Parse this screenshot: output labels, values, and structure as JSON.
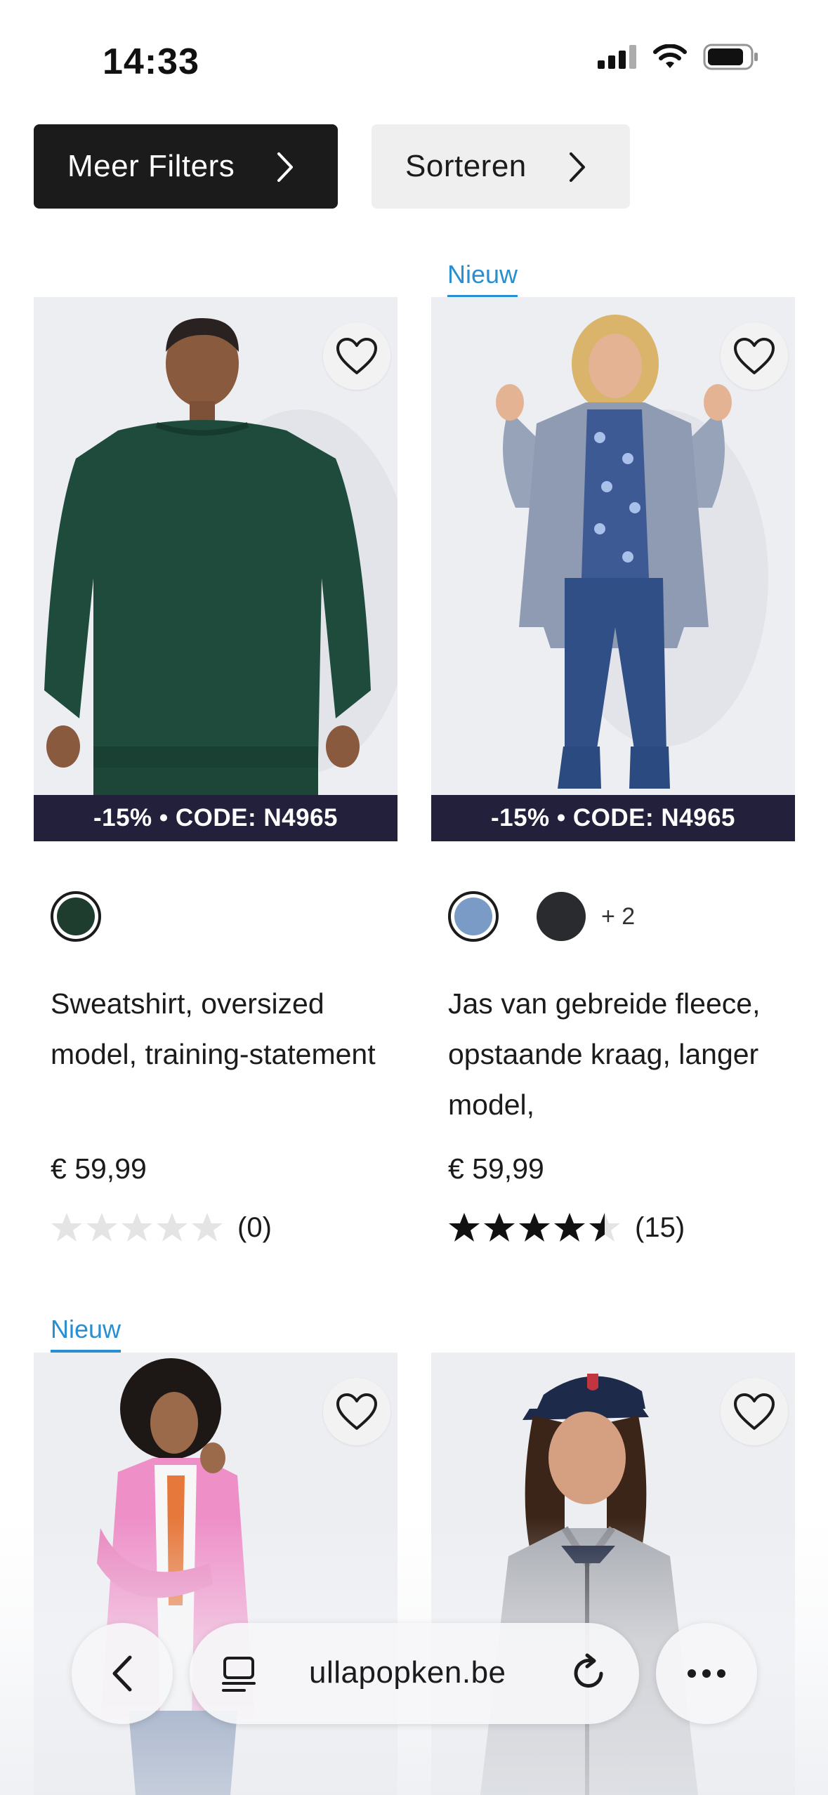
{
  "status_bar": {
    "time": "14:33"
  },
  "filters": {
    "more_label": "Meer Filters",
    "sort_label": "Sorteren"
  },
  "products": [
    {
      "badge": "",
      "promo": "-15% • CODE: N4965",
      "title": "Sweatshirt, oversized model, training-statement",
      "price": "€ 59,99",
      "rating_stars": 0,
      "reviews": "(0)",
      "swatch_colors": [
        "#1f3d2f"
      ],
      "more_colors": ""
    },
    {
      "badge": "Nieuw",
      "promo": "-15% • CODE: N4965",
      "title": "Jas van gebreide fleece, opstaande kraag, langer model,",
      "price": "€ 59,99",
      "rating_stars": 4.5,
      "reviews": "(15)",
      "swatch_colors": [
        "#7b9bc7",
        "#2a2b2e"
      ],
      "more_colors": "+ 2"
    },
    {
      "badge": "Nieuw"
    },
    {
      "badge": ""
    }
  ],
  "browser": {
    "url": "ullapopken.be"
  },
  "colors": {
    "accent": "#2a8fd0",
    "promo_bg": "#22203a",
    "dark_button": "#1b1b1b"
  }
}
